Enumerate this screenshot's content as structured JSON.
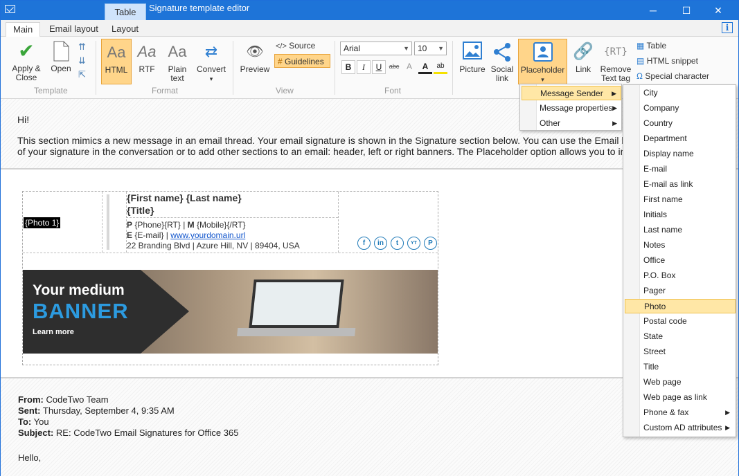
{
  "window": {
    "title": "Signature template editor",
    "context_tab": "Table",
    "controls": {
      "minimize": "─",
      "maximize": "☐",
      "close": "✕"
    }
  },
  "tabs": [
    {
      "label": "Main",
      "active": true
    },
    {
      "label": "Email layout",
      "active": false
    },
    {
      "label": "Layout",
      "active": false
    }
  ],
  "info_label": "i",
  "ribbon": {
    "template": {
      "group_label": "Template",
      "apply_close": "Apply &",
      "apply_close_2": "Close",
      "open": "Open"
    },
    "format": {
      "group_label": "Format",
      "html": "HTML",
      "rtf": "RTF",
      "plain": "Plain",
      "plain_2": "text",
      "convert": "Convert",
      "convert_arrow": "▾",
      "aa": "Aa"
    },
    "view": {
      "group_label": "View",
      "preview": "Preview",
      "source": "Source",
      "source_icon": "</>",
      "guidelines": "Guidelines",
      "guidelines_icon": "#"
    },
    "font": {
      "group_label": "Font",
      "family": "Arial",
      "size": "10",
      "bold": "B",
      "italic": "I",
      "underline": "U",
      "strike": "abc",
      "clear": "A",
      "color": "A",
      "highlight": "ab"
    },
    "insert": {
      "picture": "Picture",
      "social": "Social",
      "social_2": "link",
      "placeholder": "Placeholder",
      "placeholder_arrow": "▾",
      "link": "Link",
      "remove": "Remove",
      "remove_2": "Text tag",
      "rt_icon": "{RT}",
      "table": "Table",
      "html_snippet": "HTML snippet",
      "special_char": "Special character"
    }
  },
  "content": {
    "greeting": "Hi!",
    "intro_1": "This section mimics a new message in an email thread. Your email signature is shown in the Signature section below. You can use the Email layout ta",
    "intro_2": "of your signature in the conversation or to add other sections to an email: header, left or right banners. The Placeholder option allows you to insert e.g. A",
    "signature": {
      "photo": "{Photo 1}",
      "name": "{First name} {Last name}",
      "title": "{Title}",
      "p_label": "P",
      "phone": "{Phone}{RT}",
      "sep": " | ",
      "m_label": "M",
      "mobile": "{Mobile}{/RT}",
      "e_label": "E",
      "email": "{E-mail}",
      "url": "www.yourdomain.url",
      "address": "22 Branding Blvd | Azure Hill, NV | 89404, USA",
      "social_icons": [
        {
          "icon": "facebook-icon",
          "glyph": "f"
        },
        {
          "icon": "linkedin-icon",
          "glyph": "in"
        },
        {
          "icon": "twitter-icon",
          "glyph": "t"
        },
        {
          "icon": "youtube-icon",
          "glyph": "YT"
        },
        {
          "icon": "pinterest-icon",
          "glyph": "P"
        }
      ]
    },
    "banner": {
      "line1": "Your medium",
      "line2": "BANNER",
      "line3": "Learn more"
    },
    "reply": {
      "from_label": "From:",
      "from": "CodeTwo Team",
      "sent_label": "Sent:",
      "sent": "Thursday, September 4, 9:35 AM",
      "to_label": "To:",
      "to": "You",
      "subject_label": "Subject:",
      "subject": "RE: CodeTwo Email Signatures for Office 365",
      "hello": "Hello,"
    }
  },
  "placeholder_menu": [
    {
      "label": "Message Sender",
      "has_submenu": true,
      "selected": true
    },
    {
      "label": "Message properties",
      "has_submenu": true,
      "selected": false
    },
    {
      "label": "Other",
      "has_submenu": true,
      "selected": false
    }
  ],
  "sender_submenu": [
    {
      "label": "City"
    },
    {
      "label": "Company"
    },
    {
      "label": "Country"
    },
    {
      "label": "Department"
    },
    {
      "label": "Display name"
    },
    {
      "label": "E-mail"
    },
    {
      "label": "E-mail as link"
    },
    {
      "label": "First name"
    },
    {
      "label": "Initials"
    },
    {
      "label": "Last name"
    },
    {
      "label": "Notes"
    },
    {
      "label": "Office"
    },
    {
      "label": "P.O. Box"
    },
    {
      "label": "Pager"
    },
    {
      "label": "Photo",
      "selected": true
    },
    {
      "label": "Postal code"
    },
    {
      "label": "State"
    },
    {
      "label": "Street"
    },
    {
      "label": "Title"
    },
    {
      "label": "Web page"
    },
    {
      "label": "Web page as link"
    },
    {
      "label": "Phone & fax",
      "has_submenu": true
    },
    {
      "label": "Custom AD attributes",
      "has_submenu": true
    }
  ],
  "submenu_arrow": "▶",
  "colors": {
    "titlebar": "#1e74d8",
    "highlight": "#ffd58a",
    "accent_blue": "#2c9be0"
  }
}
